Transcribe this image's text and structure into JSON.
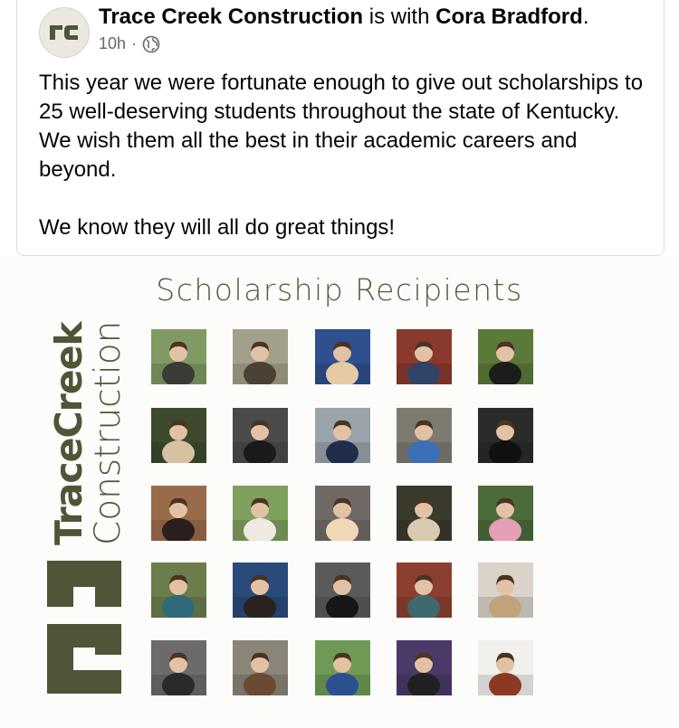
{
  "post": {
    "author": "Trace Creek Construction",
    "with_text": "is with",
    "tagged": "Cora Bradford",
    "time": "10h",
    "separator": "·",
    "privacy_icon": "globe-icon",
    "paragraph1": "This year we were fortunate enough to give out scholarships to 25 well-deserving students throughout the state of Kentucky.  We wish them all the best in their academic careers and beyond.",
    "paragraph2": "We know they will all do great things!"
  },
  "avatar": {
    "monogram": "tc"
  },
  "image": {
    "title": "Scholarship Recipients",
    "logo_line1": "TraceCreek",
    "logo_line2": "Construction",
    "brand_color": "#4f5537",
    "photos": [
      {
        "bg": "#7f9a62",
        "fg": "#3b3a34",
        "name": "recipient-photo-1"
      },
      {
        "bg": "#a2a08a",
        "fg": "#4a4134",
        "name": "recipient-photo-2"
      },
      {
        "bg": "#2f4f8e",
        "fg": "#e4cba5",
        "name": "recipient-photo-3"
      },
      {
        "bg": "#8a3a2d",
        "fg": "#2f4466",
        "name": "recipient-photo-4"
      },
      {
        "bg": "#5b7a3a",
        "fg": "#1c1c1c",
        "name": "recipient-photo-5"
      },
      {
        "bg": "#3d4a2d",
        "fg": "#d8c0a3",
        "name": "recipient-photo-6"
      },
      {
        "bg": "#4a4a4a",
        "fg": "#1b1b1b",
        "name": "recipient-photo-7"
      },
      {
        "bg": "#9aa3a9",
        "fg": "#1f2d4a",
        "name": "recipient-photo-8"
      },
      {
        "bg": "#7d7a70",
        "fg": "#3c6fb5",
        "name": "recipient-photo-9"
      },
      {
        "bg": "#2b2b2b",
        "fg": "#111111",
        "name": "recipient-photo-10"
      },
      {
        "bg": "#9a6b4a",
        "fg": "#2a1f1a",
        "name": "recipient-photo-11"
      },
      {
        "bg": "#7ea05d",
        "fg": "#efe9e3",
        "name": "recipient-photo-12"
      },
      {
        "bg": "#6f6a66",
        "fg": "#f0d7b6",
        "name": "recipient-photo-13"
      },
      {
        "bg": "#3a3a2d",
        "fg": "#d9c9b0",
        "name": "recipient-photo-14"
      },
      {
        "bg": "#4b6b3a",
        "fg": "#e39fb4",
        "name": "recipient-photo-15"
      },
      {
        "bg": "#6a7d4a",
        "fg": "#2e6a7a",
        "name": "recipient-photo-16"
      },
      {
        "bg": "#2a4a7a",
        "fg": "#2a221f",
        "name": "recipient-photo-17"
      },
      {
        "bg": "#5a5a5a",
        "fg": "#161616",
        "name": "recipient-photo-18"
      },
      {
        "bg": "#8c3f30",
        "fg": "#3d6a6e",
        "name": "recipient-photo-19"
      },
      {
        "bg": "#d9d3c9",
        "fg": "#c2a27a",
        "name": "recipient-photo-20"
      },
      {
        "bg": "#6c6a6a",
        "fg": "#2a2a2a",
        "name": "recipient-photo-21"
      },
      {
        "bg": "#8a8578",
        "fg": "#6a4a32",
        "name": "recipient-photo-22"
      },
      {
        "bg": "#6f9a55",
        "fg": "#2c4f8f",
        "name": "recipient-photo-23"
      },
      {
        "bg": "#4a3a6a",
        "fg": "#202020",
        "name": "recipient-photo-24"
      },
      {
        "bg": "#f2f0ec",
        "fg": "#8a3a22",
        "name": "recipient-photo-25"
      }
    ]
  }
}
